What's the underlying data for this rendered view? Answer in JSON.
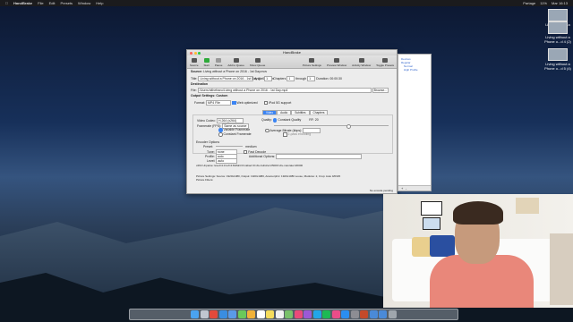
{
  "menubar": {
    "app": "HandBrake",
    "items": [
      "File",
      "Edit",
      "Presets",
      "Window",
      "Help"
    ],
    "status": [
      "Partage",
      "11%",
      "Mar 16:13"
    ]
  },
  "desktop_icons": [
    {
      "label": "Living without a Phone..."
    },
    {
      "label": "Living without a Phone o...d 4 (2)"
    },
    {
      "label": "Living without a Phone o...d 5 (4)"
    }
  ],
  "handbrake": {
    "title": "HandBrake",
    "toolbar": [
      "Source",
      "Start",
      "Pause",
      "Add to Queue",
      "Show Queue",
      "Picture Settings",
      "Preview Window",
      "Activity Window",
      "Toggle Presets"
    ],
    "source_label": "Source:",
    "source_value": "Living without a Phone on 2016 - 1st Day.mov",
    "title_label": "Title:",
    "title_value": "Living without a Phone on 2016 - 1st Day 1 - 00h02m",
    "angle_label": "Angle:",
    "angle_value": "1",
    "chapters_label": "Chapters",
    "chapters_from": "1",
    "through_label": "through",
    "chapters_to": "1",
    "duration": "Duration: 00:00:30",
    "destination_label": "Destination",
    "file_label": "File:",
    "file_value": "/Users/nithefranc/Living without a Phone on 2016 - 1st Day.mp4",
    "browse_label": "Browse...",
    "output_label": "Output Settings: Custom",
    "format_label": "Format:",
    "format_value": "MP4 File",
    "web_optimized": "Web optimized",
    "ipod_support": "iPod 5G support",
    "tabs": [
      "Video",
      "Audio",
      "Subtitles",
      "Chapters"
    ],
    "video_codec_label": "Video Codec:",
    "video_codec_value": "H.264 (x264)",
    "framerate_label": "Framerate (FPS):",
    "framerate_value": "Same as source",
    "variable_fr": "Variable Framerate",
    "constant_fr": "Constant Framerate",
    "quality_label": "Quality:",
    "constant_quality": "Constant Quality",
    "rf_label": "RF:",
    "rf_value": "20",
    "avg_bitrate": "Average Bitrate (kbps):",
    "two_pass": "2-pass encoding",
    "encoder_options": "Encoder Options",
    "preset_label": "Preset:",
    "preset_value": "medium",
    "tune_label": "Tune:",
    "tune_value": "none",
    "fast_decode": "Fast Decode",
    "profile_label": "Profile:",
    "profile_value": "auto",
    "additional_options": "Additional Options:",
    "level_label": "Level:",
    "level_value": "auto",
    "x264_line": "x264 Unparse: level=4.0:ref=4:8x8dct=0:cabac=0:vbv-bufsize=25000:vbv-maxrate=20000",
    "picture_settings": "Picture Settings: Source: 1920x1080, Output: 1920x1080, Anamorphic: 1920x1080 Loose, Modulus: 2, Crop: Auto 0/0/0/0",
    "picture_filters": "Picture Filters:",
    "status": "No encode pending"
  },
  "queue": {
    "items": [
      "Devices",
      "Regular",
      "Normal",
      "High Profile"
    ]
  },
  "dock": {
    "apps": [
      "finder",
      "launchpad",
      "chrome",
      "safari",
      "mail",
      "messages",
      "photos",
      "calendar",
      "notes",
      "reminders",
      "maps",
      "music",
      "podcasts",
      "skype",
      "spotify",
      "itunes",
      "appstore",
      "settings",
      "finder2",
      "folder",
      "folder2",
      "trash"
    ]
  }
}
